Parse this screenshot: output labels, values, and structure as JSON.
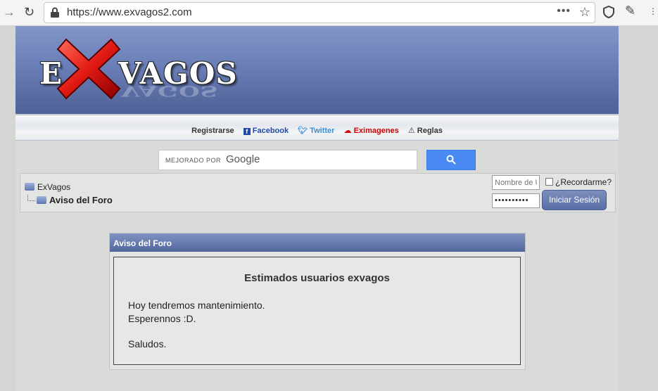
{
  "browser": {
    "url": "https://www.exvagos2.com",
    "more_label": "•••"
  },
  "logo": {
    "left": "E",
    "right": "VAGOS"
  },
  "nav_links": {
    "register": "Registrarse",
    "facebook": "Facebook",
    "twitter": "Twitter",
    "eximagenes": "Eximagenes",
    "rules": "Reglas"
  },
  "search": {
    "enhanced_by": "MEJORADO POR",
    "brand": "Google"
  },
  "breadcrumb": {
    "root": "ExVagos",
    "current": "Aviso del Foro"
  },
  "login": {
    "username_placeholder": "Nombre de U",
    "password_mask": "••••••••••",
    "remember_label": "¿Recordarme?",
    "submit_label": "Iniciar Sesión"
  },
  "notice": {
    "header": "Aviso del Foro",
    "title": "Estimados usuarios exvagos",
    "line1": "Hoy tendremos mantenimiento.",
    "line2": "Esperennos :D.",
    "line3": "Saludos."
  },
  "colors": {
    "header_blue": "#6a7fb7",
    "facebook": "#1f4aa8",
    "twitter": "#3b8fd6",
    "eximagenes": "#d20000",
    "search_button": "#4a8af4"
  }
}
